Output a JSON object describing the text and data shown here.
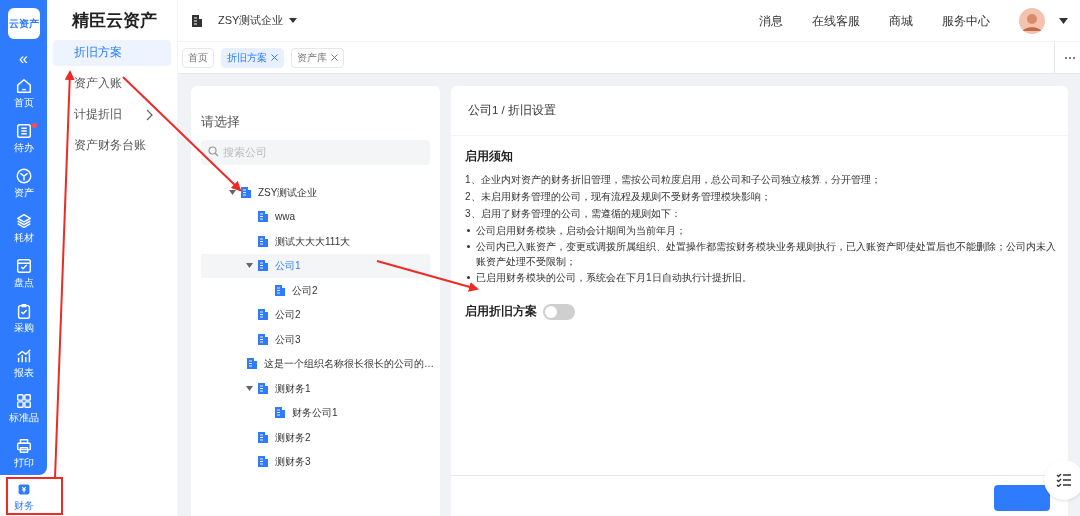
{
  "rail": {
    "logo": "云资产",
    "collapse": "«",
    "items": [
      {
        "label": "首页",
        "selected": false,
        "badge": false
      },
      {
        "label": "待办",
        "selected": false,
        "badge": true
      },
      {
        "label": "资产",
        "selected": false,
        "badge": false
      },
      {
        "label": "耗材",
        "selected": false,
        "badge": false
      },
      {
        "label": "盘点",
        "selected": false,
        "badge": false
      },
      {
        "label": "采购",
        "selected": false,
        "badge": false
      },
      {
        "label": "报表",
        "selected": false,
        "badge": false
      },
      {
        "label": "标准品",
        "selected": false,
        "badge": false
      },
      {
        "label": "打印",
        "selected": false,
        "badge": false
      },
      {
        "label": "财务",
        "selected": true,
        "badge": false
      }
    ]
  },
  "submenu": {
    "title": "精臣云资产",
    "items": [
      {
        "label": "折旧方案",
        "selected": true,
        "has_children": false
      },
      {
        "label": "资产入账",
        "selected": false,
        "has_children": false
      },
      {
        "label": "计提折旧",
        "selected": false,
        "has_children": true
      },
      {
        "label": "资产财务台账",
        "selected": false,
        "has_children": false
      }
    ]
  },
  "header": {
    "company": "ZSY测试企业",
    "links": [
      "消息",
      "在线客服",
      "商城",
      "服务中心"
    ]
  },
  "tabs": [
    {
      "label": "首页",
      "selected": false,
      "closable": false
    },
    {
      "label": "折旧方案",
      "selected": true,
      "closable": true
    },
    {
      "label": "资产库",
      "selected": false,
      "closable": true
    }
  ],
  "tree_panel": {
    "title": "请选择",
    "search": {
      "placeholder": "搜索公司"
    },
    "tree": [
      {
        "label": "ZSY测试企业",
        "selected": false,
        "expanded": true,
        "children": [
          {
            "label": "wwa",
            "selected": false
          },
          {
            "label": "测试大大大111大",
            "selected": false
          },
          {
            "label": "公司1",
            "selected": true,
            "expanded": true,
            "children": [
              {
                "label": "公司2",
                "selected": false
              }
            ]
          },
          {
            "label": "公司2",
            "selected": false
          },
          {
            "label": "公司3",
            "selected": false
          },
          {
            "label": "这是一个组织名称很长很长的公司的…",
            "selected": false
          },
          {
            "label": "测财务1",
            "selected": false,
            "expanded": true,
            "children": [
              {
                "label": "财务公司1",
                "selected": false
              }
            ]
          },
          {
            "label": "测财务2",
            "selected": false
          },
          {
            "label": "测财务3",
            "selected": false
          }
        ]
      }
    ]
  },
  "settings": {
    "breadcrumb": "公司1 / 折旧设置",
    "notice_title": "启用须知",
    "notice": [
      {
        "kind": "para",
        "text": "1、企业内对资产的财务折旧管理，需按公司粒度启用，总公司和子公司独立核算，分开管理；"
      },
      {
        "kind": "para",
        "text": "2、未启用财务管理的公司，现有流程及规则不受财务管理模块影响；"
      },
      {
        "kind": "para",
        "text": "3、启用了财务管理的公司，需遵循的规则如下："
      },
      {
        "kind": "bullet",
        "text": "公司启用财务模块，启动会计期间为当前年月；"
      },
      {
        "kind": "bullet",
        "text": "公司内已入账资产，变更或调拨所属组织、处置操作都需按财务模块业务规则执行，已入账资产即使处置后也不能删除；公司内未入账资产处理不受限制；"
      },
      {
        "kind": "bullet",
        "text": "已启用财务模块的公司，系统会在下月1日自动执行计提折旧。"
      }
    ],
    "toggle": {
      "label": "启用折旧方案",
      "on": false
    }
  }
}
